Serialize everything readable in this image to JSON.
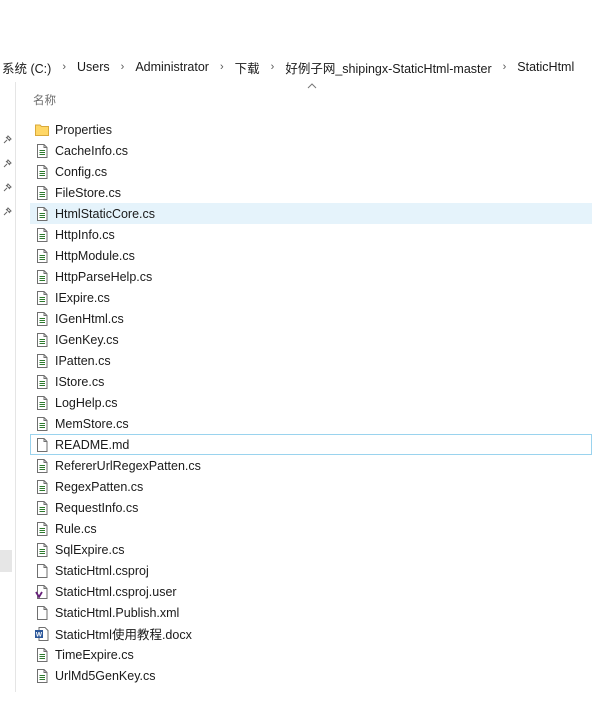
{
  "breadcrumb": [
    "系统 (C:)",
    "Users",
    "Administrator",
    "下载",
    "好例子网_shipingx-StaticHtml-master",
    "StaticHtml"
  ],
  "column_header": "名称",
  "files": [
    {
      "name": "Properties",
      "icon": "folder-icon"
    },
    {
      "name": "CacheInfo.cs",
      "icon": "cs-file-icon"
    },
    {
      "name": "Config.cs",
      "icon": "cs-file-icon"
    },
    {
      "name": "FileStore.cs",
      "icon": "cs-file-icon"
    },
    {
      "name": "HtmlStaticCore.cs",
      "icon": "cs-file-icon"
    },
    {
      "name": "HttpInfo.cs",
      "icon": "cs-file-icon"
    },
    {
      "name": "HttpModule.cs",
      "icon": "cs-file-icon"
    },
    {
      "name": "HttpParseHelp.cs",
      "icon": "cs-file-icon"
    },
    {
      "name": "IExpire.cs",
      "icon": "cs-file-icon"
    },
    {
      "name": "IGenHtml.cs",
      "icon": "cs-file-icon"
    },
    {
      "name": "IGenKey.cs",
      "icon": "cs-file-icon"
    },
    {
      "name": "IPatten.cs",
      "icon": "cs-file-icon"
    },
    {
      "name": "IStore.cs",
      "icon": "cs-file-icon"
    },
    {
      "name": "LogHelp.cs",
      "icon": "cs-file-icon"
    },
    {
      "name": "MemStore.cs",
      "icon": "cs-file-icon"
    },
    {
      "name": "README.md",
      "icon": "blank-file-icon"
    },
    {
      "name": "RefererUrlRegexPatten.cs",
      "icon": "cs-file-icon"
    },
    {
      "name": "RegexPatten.cs",
      "icon": "cs-file-icon"
    },
    {
      "name": "RequestInfo.cs",
      "icon": "cs-file-icon"
    },
    {
      "name": "Rule.cs",
      "icon": "cs-file-icon"
    },
    {
      "name": "SqlExpire.cs",
      "icon": "cs-file-icon"
    },
    {
      "name": "StaticHtml.csproj",
      "icon": "blank-file-icon"
    },
    {
      "name": "StaticHtml.csproj.user",
      "icon": "vs-user-file-icon"
    },
    {
      "name": "StaticHtml.Publish.xml",
      "icon": "blank-file-icon"
    },
    {
      "name": "StaticHtml使用教程.docx",
      "icon": "word-doc-icon"
    },
    {
      "name": "TimeExpire.cs",
      "icon": "cs-file-icon"
    },
    {
      "name": "UrlMd5GenKey.cs",
      "icon": "cs-file-icon"
    }
  ],
  "hover_item": "HtmlStaticCore.cs",
  "focused_item": "README.md",
  "colors": {
    "hover": "#e5f3fb",
    "focus_border": "#9ad3ee",
    "folder": "#ffd766",
    "word": "#2b579a",
    "vs": "#68217a"
  }
}
